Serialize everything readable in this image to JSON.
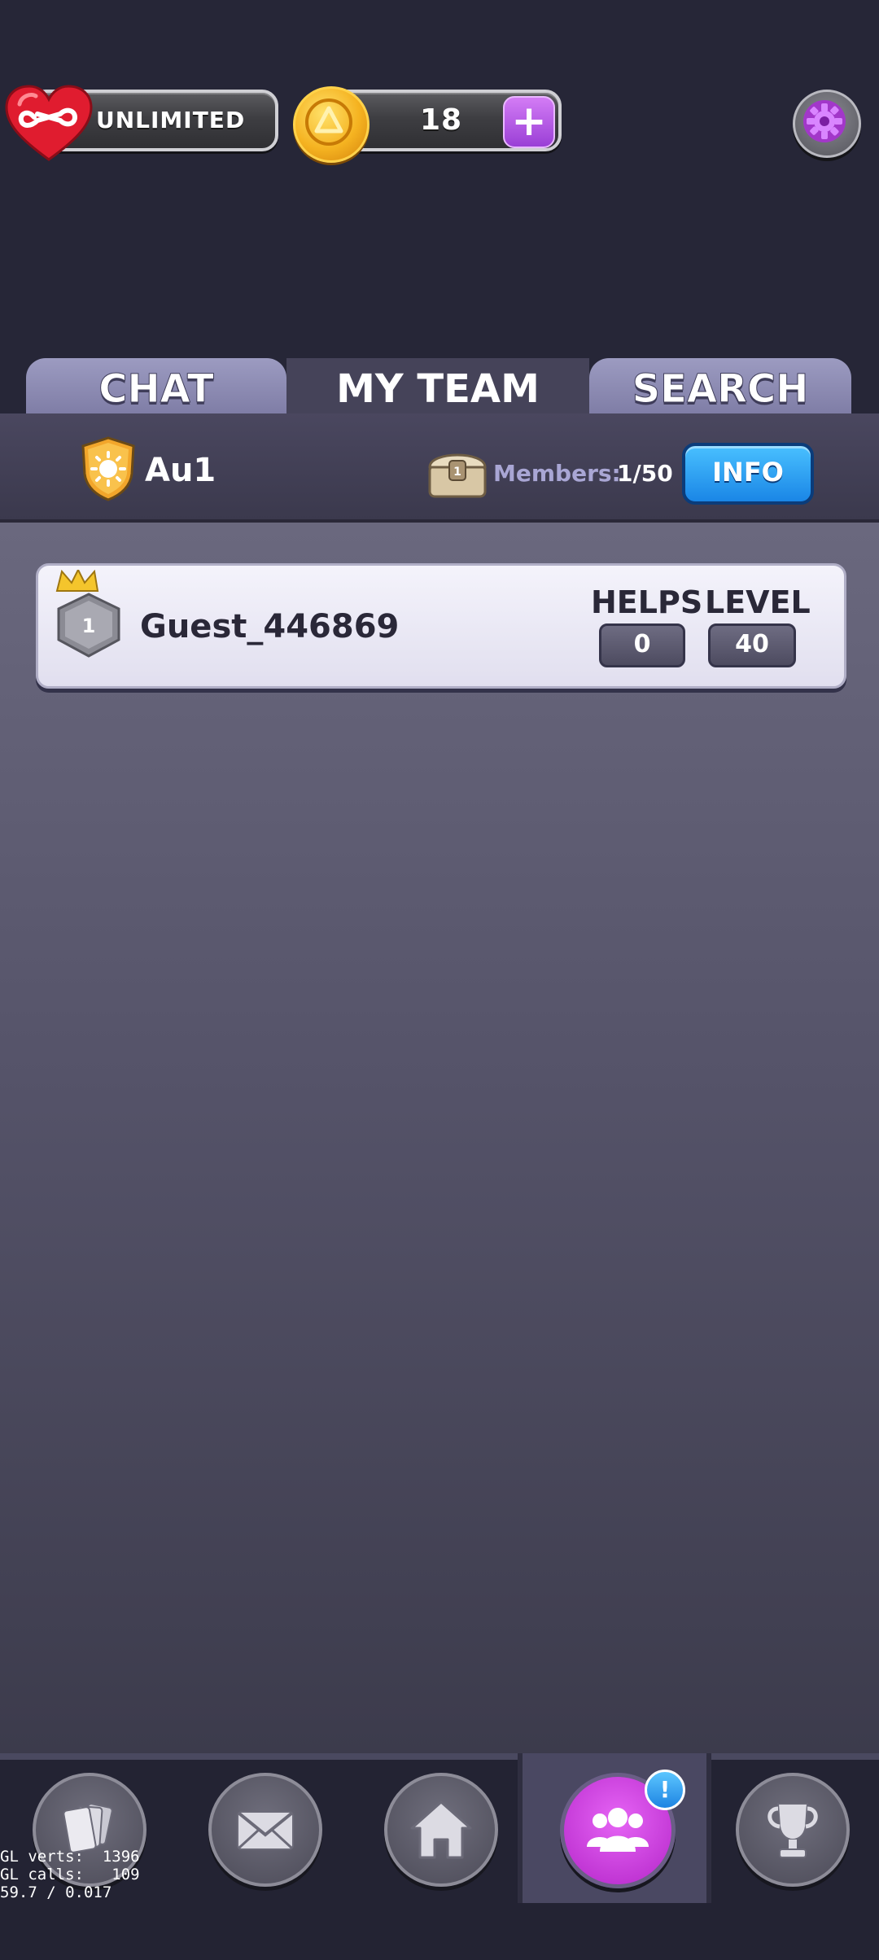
{
  "top_bar": {
    "lives_text": "UNLIMITED",
    "coins_value": "18",
    "coin_plus": "+"
  },
  "tabs": [
    {
      "label": "CHAT",
      "active": false
    },
    {
      "label": "MY TEAM",
      "active": true
    },
    {
      "label": "SEARCH",
      "active": false
    }
  ],
  "team": {
    "name": "Au1",
    "members_label": "Members:",
    "members_value": "1/50",
    "info_button": "INFO"
  },
  "members": [
    {
      "rank": "1",
      "name": "Guest_446869",
      "helps_label": "HELPS",
      "helps_value": "0",
      "level_label": "LEVEL",
      "level_value": "40"
    }
  ],
  "bottom_nav": {
    "items": [
      "cards-icon",
      "mail-icon",
      "home-icon",
      "team-icon",
      "trophy-icon"
    ],
    "active": "team-icon",
    "notification": "!"
  },
  "debug": {
    "line1": "GL verts:  1396",
    "line2": "GL calls:   109",
    "line3": "59.7 / 0.017"
  },
  "colors": {
    "background": "#262637",
    "accent_purple": "#b426c9",
    "info_blue": "#1a86e6",
    "coin_gold": "#f5b321"
  }
}
